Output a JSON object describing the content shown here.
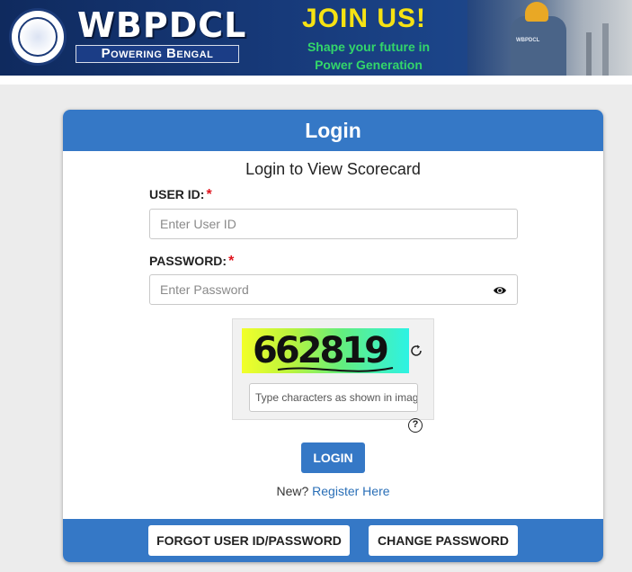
{
  "banner": {
    "brand": "WBPDCL",
    "tagline": "Powering Bengal",
    "join_title": "JOIN US!",
    "join_line1": "Shape your future in",
    "join_line2": "Power Generation",
    "worker_label": "WBPDCL",
    "colors": {
      "navy": "#173a7a",
      "join_yellow": "#f6e213",
      "join_green": "#33d66a"
    }
  },
  "login": {
    "header": "Login",
    "subtitle": "Login to View Scorecard",
    "user_id_label": "USER ID:",
    "user_id_placeholder": "Enter User ID",
    "password_label": "PASSWORD:",
    "password_placeholder": "Enter Password",
    "required_mark": "*",
    "show_password_icon": "eye-icon",
    "captcha_text": "662819",
    "captcha_placeholder": "Type characters as shown in image",
    "refresh_icon": "refresh-icon",
    "help_symbol": "?",
    "login_button": "LOGIN",
    "new_prompt": "New?",
    "register_link": "Register Here",
    "forgot_button": "FORGOT USER ID/PASSWORD",
    "change_password_button": "CHANGE PASSWORD",
    "colors": {
      "primary": "#3578c6",
      "required": "#e0141e",
      "link": "#2a6fb7"
    }
  }
}
